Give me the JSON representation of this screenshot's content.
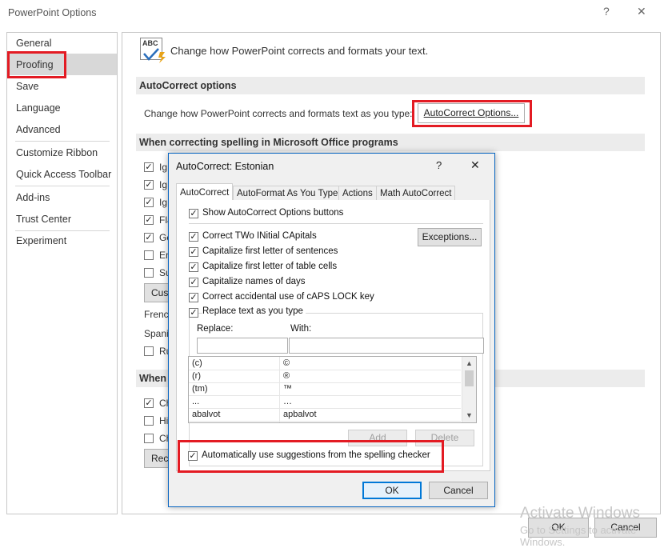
{
  "window": {
    "title": "PowerPoint Options",
    "help_glyph": "?",
    "close_glyph": "✕",
    "ok_label": "OK",
    "cancel_label": "Cancel"
  },
  "nav": {
    "items": [
      "General",
      "Proofing",
      "Save",
      "Language",
      "Advanced",
      "Customize Ribbon",
      "Quick Access Toolbar",
      "Add-ins",
      "Trust Center",
      "Experiment"
    ],
    "selected": "Proofing"
  },
  "main": {
    "header_text": "Change how PowerPoint corrects and formats your text.",
    "header_icon_text": "ABC",
    "autocorrect_section": "AutoCorrect options",
    "autocorrect_desc": "Change how PowerPoint corrects and formats text as you type:",
    "autocorrect_button": "AutoCorrect Options...",
    "spelling_section": "When correcting spelling in Microsoft Office programs",
    "spelling_checks": [
      {
        "text": "Ig",
        "checked": true
      },
      {
        "text": "Ig",
        "checked": true
      },
      {
        "text": "Ig",
        "checked": true
      },
      {
        "text": "Fla",
        "checked": true
      },
      {
        "text": "Ge",
        "checked": true
      },
      {
        "text": "En",
        "checked": false
      },
      {
        "text": "Su",
        "checked": false
      }
    ],
    "custom_button": "Cust",
    "french_label": "Frenc",
    "spanish_label": "Spani",
    "ru_check": {
      "text": "Ru",
      "checked": false
    },
    "when_section": "When c",
    "when_checks": [
      {
        "text": "Ch",
        "checked": true
      },
      {
        "text": "Hi",
        "checked": false
      },
      {
        "text": "Ch",
        "checked": false
      }
    ],
    "recheck_button": "Rech"
  },
  "dialog": {
    "title": "AutoCorrect: Estonian",
    "help_glyph": "?",
    "close_glyph": "✕",
    "tabs": [
      "AutoCorrect",
      "AutoFormat As You Type",
      "Actions",
      "Math AutoCorrect"
    ],
    "active_tab": "AutoCorrect",
    "show_buttons": {
      "text": "Show AutoCorrect Options buttons",
      "checked": true
    },
    "options": [
      {
        "text": "Correct TWo INitial CApitals",
        "checked": true
      },
      {
        "text": "Capitalize first letter of sentences",
        "checked": true
      },
      {
        "text": "Capitalize first letter of table cells",
        "checked": true
      },
      {
        "text": "Capitalize names of days",
        "checked": true
      },
      {
        "text": "Correct accidental use of cAPS LOCK key",
        "checked": true
      }
    ],
    "exceptions_button": "Exceptions...",
    "replace_group": {
      "text": "Replace text as you type",
      "checked": true
    },
    "replace_label": "Replace:",
    "with_label": "With:",
    "replace_value": "",
    "with_value": "",
    "entries": [
      {
        "replace": "(c)",
        "with": "©"
      },
      {
        "replace": "(r)",
        "with": "®"
      },
      {
        "replace": "(tm)",
        "with": "™"
      },
      {
        "replace": "...",
        "with": "…"
      },
      {
        "replace": "abalvot",
        "with": "apbalvot"
      }
    ],
    "add_button": "Add",
    "delete_button": "Delete",
    "auto_suggest": {
      "text": "Automatically use suggestions from the spelling checker",
      "checked": true
    },
    "ok_label": "OK",
    "cancel_label": "Cancel"
  },
  "watermark": {
    "line1": "Activate Windows",
    "line2": "Go to Settings to activate Windows."
  }
}
